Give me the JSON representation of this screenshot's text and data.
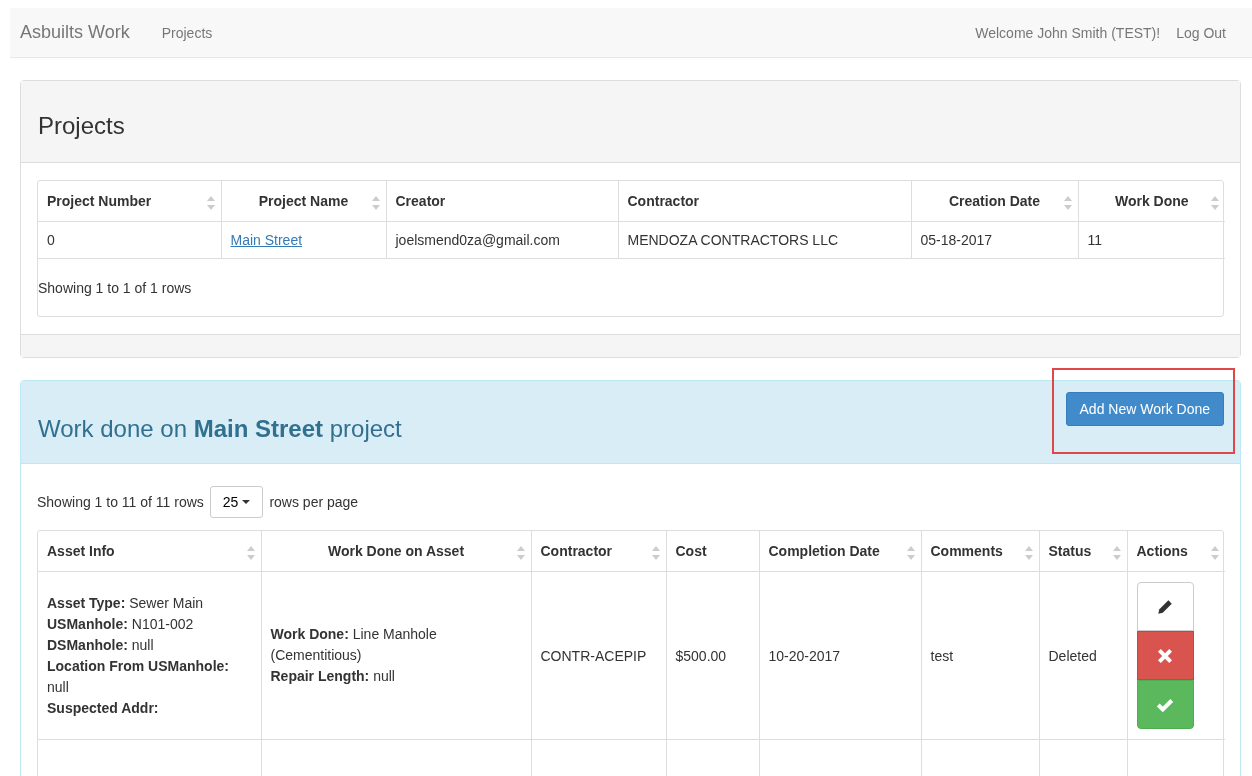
{
  "navbar": {
    "brand": "Asbuilts Work",
    "links": [
      "Projects"
    ],
    "welcome": "Welcome John Smith (TEST)!",
    "logout": "Log Out"
  },
  "projects_panel": {
    "title": "Projects",
    "columns": [
      {
        "label": "Project Number",
        "sortable": true
      },
      {
        "label": "Project Name",
        "sortable": true
      },
      {
        "label": "Creator",
        "sortable": false
      },
      {
        "label": "Contractor",
        "sortable": false
      },
      {
        "label": "Creation Date",
        "sortable": true
      },
      {
        "label": "Work Done",
        "sortable": true
      }
    ],
    "rows": [
      {
        "cells": [
          {
            "text": "0",
            "kind": "text"
          },
          {
            "text": "Main Street",
            "kind": "link"
          },
          {
            "text": "joelsmend0za@gmail.com",
            "kind": "text"
          },
          {
            "text": "MENDOZA CONTRACTORS LLC",
            "kind": "text"
          },
          {
            "text": "05-18-2017",
            "kind": "text"
          },
          {
            "text": "11",
            "kind": "text"
          }
        ]
      }
    ],
    "summary": "Showing 1 to 1 of 1 rows"
  },
  "work_panel": {
    "title": "Work done on **Main Street** project",
    "add_button": "Add New Work Done",
    "highlighted": true,
    "summary": "Showing 1 to 11 of 11 rows",
    "page_size": "25",
    "page_size_suffix": "rows per page",
    "columns": [
      {
        "label": "Asset Info",
        "sortable": true
      },
      {
        "label": "Work Done on Asset",
        "sortable": true
      },
      {
        "label": "Contractor",
        "sortable": true
      },
      {
        "label": "Cost",
        "sortable": false
      },
      {
        "label": "Completion Date",
        "sortable": true
      },
      {
        "label": "Comments",
        "sortable": true
      },
      {
        "label": "Status",
        "sortable": true
      },
      {
        "label": "Actions",
        "sortable": true
      }
    ],
    "rows": [
      {
        "asset_info": [
          "**Asset Type:** Sewer Main",
          "**USManhole:** N101-002",
          "**DSManhole:** null",
          "**Location From USManhole:** null",
          "**Suspected Addr:**"
        ],
        "work_done": [
          "**Work Done:** Line Manhole (Cementitious)",
          "**Repair Length:** null"
        ],
        "contractor": "CONTR-ACEPIP",
        "cost": "$500.00",
        "completion_date": "10-20-2017",
        "comments": "test",
        "status": "Deleted",
        "actions": [
          {
            "kind": "edit"
          },
          {
            "kind": "delete"
          },
          {
            "kind": "approve"
          }
        ]
      }
    ]
  }
}
